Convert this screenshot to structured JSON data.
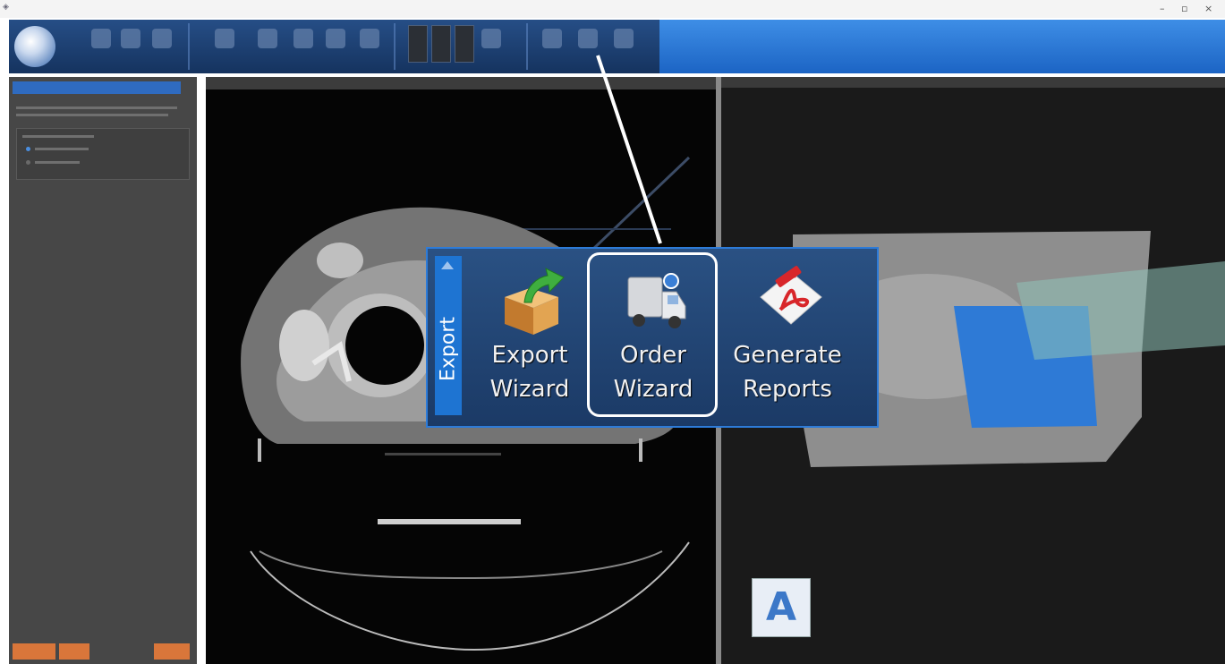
{
  "popup": {
    "tab_label": "Export",
    "buttons": [
      {
        "line1": "Export",
        "line2": "Wizard"
      },
      {
        "line1": "Order",
        "line2": "Wizard"
      },
      {
        "line1": "Generate",
        "line2": "Reports"
      }
    ]
  },
  "viewport_3d": {
    "orientation_badge": "A"
  },
  "colors": {
    "accent": "#1e74d2",
    "highlight": "#ffffff",
    "action_button": "#d9763a"
  }
}
